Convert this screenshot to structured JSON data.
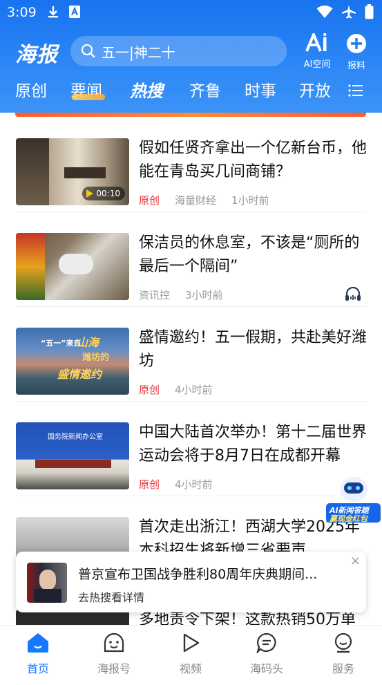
{
  "status": {
    "time": "3:09"
  },
  "header": {
    "logo": "海报",
    "search_placeholder": "五一|神二十",
    "ai_label": "AI空间",
    "report_label": "报料",
    "accent": "#1873f0"
  },
  "tabs": [
    "原创",
    "要闻",
    "热搜",
    "齐鲁",
    "时事",
    "开放"
  ],
  "active_tab": "热搜",
  "feed": [
    {
      "title": "假如任贤齐拿出一个亿新台币，他能在青岛买几间商铺？",
      "tag": "原创",
      "source": "海量财经",
      "time": "1小时前",
      "duration": "00:10"
    },
    {
      "title": "保洁员的休息室，不该是“厕所的最后一个隔间”",
      "tag": "",
      "source": "资讯控",
      "time": "3小时前"
    },
    {
      "title": "盛情邀约！五一假期，共赴美好潍坊",
      "tag": "原创",
      "source": "",
      "time": "4小时前",
      "thumb_text": [
        "“五一”来自",
        "山海",
        "潍坊的",
        "盛情邀约"
      ]
    },
    {
      "title": "中国大陆首次举办！第十二届世界运动会将于8月7日在成都开幕",
      "tag": "原创",
      "source": "",
      "time": "4小时前",
      "thumb_text": "国务院新闻办公室"
    },
    {
      "title": "首次走出浙江！西湖大学2025年本科招生将新增三省要声",
      "tag": "",
      "source": "",
      "time": ""
    },
    {
      "title": "多地责令下架！这款热销50万单",
      "tag": "",
      "source": "",
      "time": ""
    }
  ],
  "notification": {
    "title": "普京宣布卫国战争胜利80周年庆典期间...",
    "subtitle": "去热搜看详情",
    "close": "×"
  },
  "ai_badge": {
    "line1": "AI新闻答题",
    "line2": "赢现金红包"
  },
  "bottom_nav": [
    {
      "label": "首页",
      "icon": "home-icon",
      "active": true
    },
    {
      "label": "海报号",
      "icon": "face-icon",
      "active": false
    },
    {
      "label": "视频",
      "icon": "play-icon",
      "active": false
    },
    {
      "label": "海码头",
      "icon": "chat-icon",
      "active": false
    },
    {
      "label": "服务",
      "icon": "profile-icon",
      "active": false
    }
  ]
}
